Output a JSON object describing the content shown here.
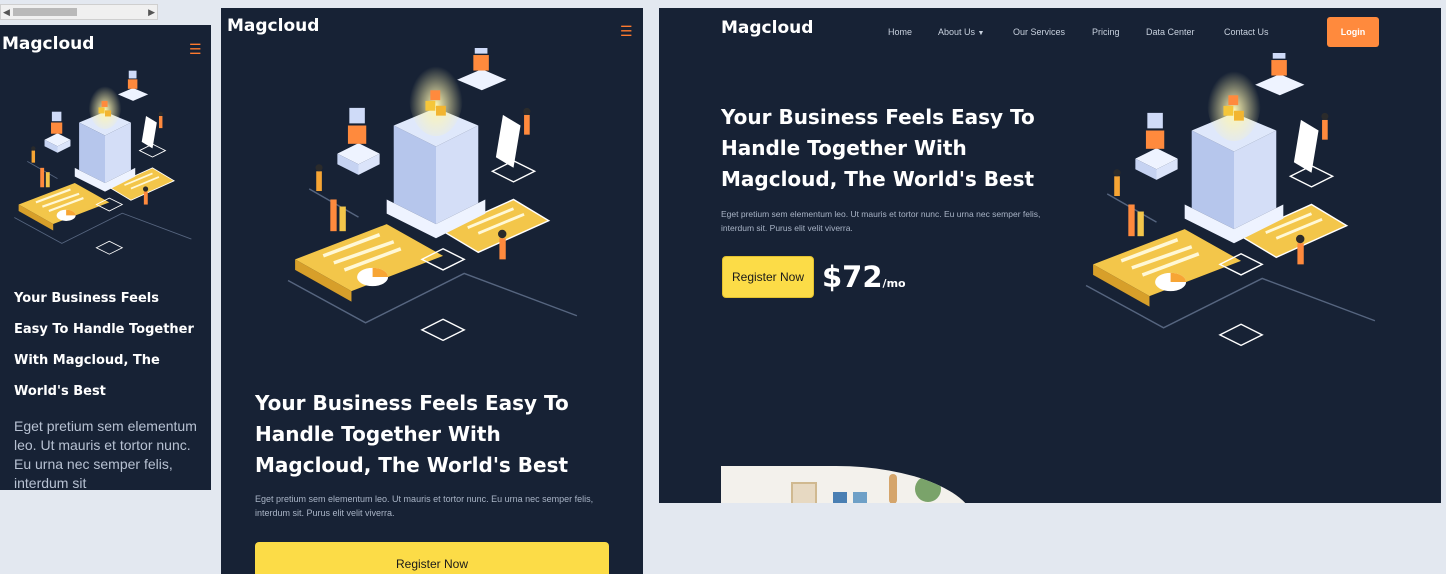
{
  "brand": "Magcloud",
  "hero": {
    "title": "Your Business Feels Easy To Handle Together With Magcloud, The World's Best",
    "description": "Eget pretium sem elementum leo. Ut mauris et tortor nunc. Eu urna nec semper felis, interdum sit. Purus elit velit viverra.",
    "description_mobile": "Eget pretium sem elementum leo. Ut mauris et tortor nunc. Eu urna nec semper felis, interdum sit",
    "register_label": "Register Now",
    "price": "$72",
    "price_unit": "/mo"
  },
  "nav": {
    "items": [
      "Home",
      "About Us",
      "Our Services",
      "Pricing",
      "Data Center",
      "Contact Us"
    ],
    "login_label": "Login"
  },
  "colors": {
    "background": "#172235",
    "accent_orange": "#ff8a3d",
    "accent_yellow": "#fcdc47"
  },
  "icons": {
    "menu": "hamburger-menu-icon",
    "dropdown": "chevron-down-icon"
  }
}
